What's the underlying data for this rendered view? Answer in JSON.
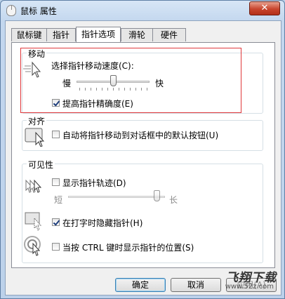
{
  "window": {
    "title": "鼠标 属性",
    "close_label": "✕"
  },
  "tabs": [
    {
      "label": "鼠标键"
    },
    {
      "label": "指针"
    },
    {
      "label": "指针选项"
    },
    {
      "label": "滑轮"
    },
    {
      "label": "硬件"
    }
  ],
  "motion": {
    "title": "移动",
    "speed_label": "选择指针移动速度(C):",
    "slow": "慢",
    "fast": "快",
    "speed_value": 0.5,
    "precision_label": "提高指针精确度(E)",
    "precision_checked": true
  },
  "snap": {
    "title": "对齐",
    "snap_label": "自动将指针移动到对话框中的默认按钮(U)",
    "snap_checked": false
  },
  "visibility": {
    "title": "可见性",
    "trails_label": "显示指针轨迹(D)",
    "trails_checked": false,
    "short": "短",
    "long": "长",
    "trails_value": 1.0,
    "hide_label": "在打字时隐藏指针(H)",
    "hide_checked": true,
    "ctrl_label": "当按 CTRL 键时显示指针的位置(S)",
    "ctrl_checked": false
  },
  "buttons": {
    "ok": "确定",
    "cancel": "取消",
    "apply": "应用(A)"
  },
  "watermark": {
    "main": "飞翔下载",
    "sub": "www.52z.com"
  }
}
